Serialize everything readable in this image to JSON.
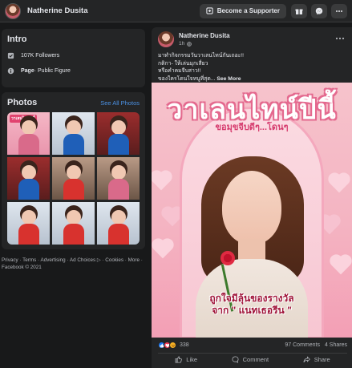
{
  "topbar": {
    "page_name": "Natherine Dusita",
    "support_label": "Become a Supporter"
  },
  "intro": {
    "title": "Intro",
    "followers_label": "107K Followers",
    "page_type_prefix": "Page",
    "page_type_suffix": " · Public Figure"
  },
  "photos": {
    "title": "Photos",
    "see_all_label": "See All Photos",
    "first_tile_tag": "วาเลนไทน์ปีนี้"
  },
  "footer": {
    "line1": "Privacy · Terms · Advertising · Ad Choices ▷ · Cookies · More ·",
    "line2": "Facebook © 2021"
  },
  "post": {
    "author": "Natherine Dusita",
    "time": "1h",
    "text_lines": [
      "มาทำกิจกรรมวันวาเลนไทน์กันเถอะ!!",
      "กติกา- ให้เล่นมุกเสี่ยว",
      "หรือคำคมจีบสาว!!",
      "ของใครโดนใจหนูที่สุด..."
    ],
    "see_more_label": "See More",
    "image": {
      "title": "วาเลนไทน์ปีนี้",
      "subtitle": "ขอมุขจีบดีๆ...โดนๆ",
      "bottom_line1": "ถูกใจมีลุ้นของรางวัล",
      "bottom_line2": "จาก \" แนทเธอรีน \""
    },
    "reaction_count": "338",
    "comments": "97 Comments",
    "shares": "4 Shares",
    "actions": {
      "like": "Like",
      "comment": "Comment",
      "share": "Share"
    }
  }
}
